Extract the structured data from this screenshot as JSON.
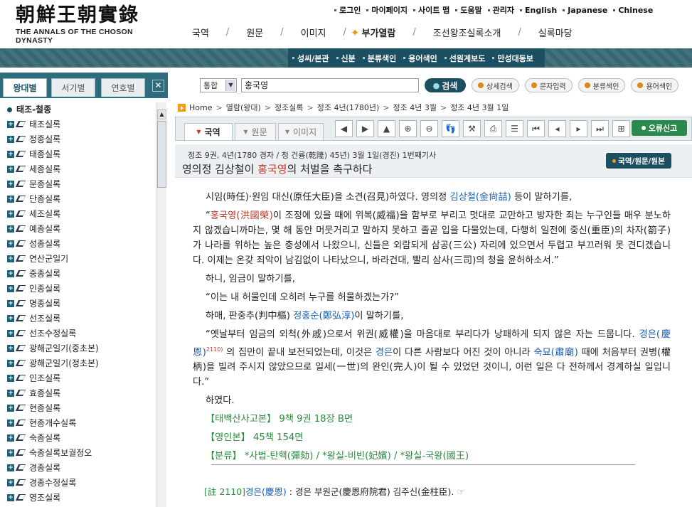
{
  "logo": {
    "hanja": "朝鮮王朝實錄",
    "english": "THE ANNALS OF THE CHOSON DYNASTY"
  },
  "util_links": [
    "로그인",
    "마이페이지",
    "사이트 맵",
    "도움말",
    "관리자",
    "English",
    "Japanese",
    "Chinese"
  ],
  "gnb": [
    {
      "label": "국역",
      "sep": "/"
    },
    {
      "label": "원문",
      "sep": "/"
    },
    {
      "label": "이미지",
      "sep": "/"
    },
    {
      "label": "부가열람",
      "sep": "/",
      "icon": "star-icon"
    },
    {
      "label": "조선왕조실록소개",
      "sep": "/"
    },
    {
      "label": "실록마당",
      "sep": ""
    }
  ],
  "subnav": [
    "성씨/본관",
    "신분",
    "분류색인",
    "용어색인",
    "선원계보도",
    "만성대동보"
  ],
  "left_tabs": {
    "tab1": "왕대별",
    "tab2": "서기별",
    "tab3": "연호별",
    "close": "✕"
  },
  "tree": {
    "root": "태조-철종",
    "items": [
      "태조실록",
      "정종실록",
      "태종실록",
      "세종실록",
      "문종실록",
      "단종실록",
      "세조실록",
      "예종실록",
      "성종실록",
      "연산군일기",
      "중종실록",
      "인종실록",
      "명종실록",
      "선조실록",
      "선조수정실록",
      "광해군일기(중초본)",
      "광해군일기(정초본)",
      "인조실록",
      "효종실록",
      "현종실록",
      "현종개수실록",
      "숙종실록",
      "숙종실록보궐정오",
      "경종실록",
      "경종수정실록",
      "영조실록"
    ]
  },
  "search": {
    "scope": "통합",
    "query": "홍국영",
    "go": "검색",
    "buttons": [
      "상세검색",
      "문자입력",
      "분류색인",
      "용어색인"
    ]
  },
  "breadcrumb": [
    "Home",
    "열람(왕대)",
    "정조실록",
    "정조 4년(1780년)",
    "정조 4년 3월",
    "정조 4년 3월 1일"
  ],
  "view_tabs": {
    "t1": "국역",
    "t2": "원문",
    "t3": "이미지"
  },
  "tools": [
    "◀",
    "▶",
    "▲",
    "⊕",
    "⊖",
    "👣",
    "⚒",
    "⎙",
    "☰",
    "⏮",
    "◂",
    "▸",
    "⏭",
    "⊞"
  ],
  "error_report": "오류신고",
  "article": {
    "meta": "정조 9권, 4년(1780 경자 / 청 건륭(乾隆) 45년) 3월 1일(경진) 1번째기사",
    "title_a": "영의정 김상철이 ",
    "title_hl": "홍국영",
    "title_b": "의 처벌을 촉구하다",
    "view_btn": "국역/원문/원본"
  },
  "text": {
    "p1a": "시임(時任)·원임 대신(原任大臣)을 소견(召見)하였다. 영의정 ",
    "p1link": "김상철(金尙喆)",
    "p1b": " 등이 말하기를,",
    "p2q": "“",
    "p2link": "홍국영(洪國榮)",
    "p2b": "이 조정에 있을 때에 위복(威福)을 함부로 부리고 멋대로 교만하고 방자한 죄는 누구인들 매우 분노하지 않겠습니까마는, 몇 해 동안 머뭇거리고 말하지 못하고 졸곧 입을 다물었는데, 다행히 일전에 중신(重臣)의 차자(箚子)가 나라를 위하는 높은 충성에서 나왔으니, 신들은 외람되게 삼공(三公) 자리에 있으면서 두렵고 부끄러워 못 견디겠습니다. 이제는 온갖 죄악이 남김없이 나타났으니, 바라건대, 빨리 삼사(三司)의 청을 윤허하소서.”",
    "p3": "하니, 임금이 말하기를,",
    "p4": "“이는 내 허물인데 오히려 누구를 허물하겠는가?”",
    "p5a": "하매, 판중추(判中樞) ",
    "p5link": "정홍순(鄭弘淳)",
    "p5b": "이 말하기를,",
    "p6a": "“옛날부터 임금의 외척(外戚)으로서 위권(威權)을 마음대로 부리다가 낭패하게 되지 않은 자는 드뭅니다. ",
    "p6link1": "경은(慶恩)",
    "p6ref": "2110)",
    "p6b": " 의 집만이 끝내 보전되었는데, 이것은 ",
    "p6link2": "경은",
    "p6c": "이 다른 사람보다 어진 것이 아니라 ",
    "p6link3": "숙묘(肅廟)",
    "p6d": " 때에 처음부터 권병(權柄)을 빌려 주시지 않았으므로 일세(一世)의 완인(完人)이 될 수 있었던 것이니, 이런 일은 다 전하께서 경계하실 일입니다.”",
    "p7": "하였다.",
    "src1k": "【태백산사고본】",
    "src1v": " 9책 9권 18장 B면",
    "src2k": "【영인본】",
    "src2v": " 45책 154면",
    "src3k": "【분류】",
    "src3v": " *사법-탄핵(彈劾) / *왕실-비빈(妃嬪) / *왕실-국왕(國王)"
  },
  "footnote": {
    "num": "[註 2110]",
    "term": "경은(慶恩)",
    "body": " : 경은 부원군(慶恩府院君) 김주신(金柱臣).",
    "hand": "☞"
  }
}
